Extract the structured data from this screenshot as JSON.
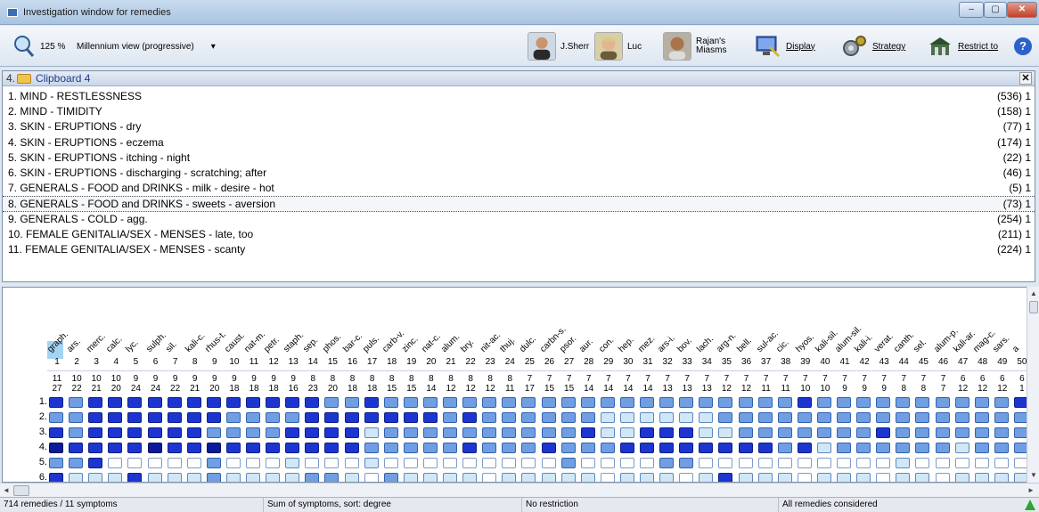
{
  "window": {
    "title": "Investigation window for remedies",
    "min": "–",
    "max": "▢",
    "close": "✕"
  },
  "toolbar": {
    "zoom": "125 %",
    "view": "Millennium view (progressive)",
    "view_arrow": "▾",
    "btn_sherr": "J.Sherr",
    "btn_luc": "Luc",
    "btn_rajan_1": "Rajan's",
    "btn_rajan_2": "Miasms",
    "btn_display": "Display",
    "btn_strategy": "Strategy",
    "btn_restrict": "Restrict to",
    "help": "?"
  },
  "clipboard": {
    "number": "4.",
    "name": "Clipboard 4",
    "close": "✕",
    "rubrics": [
      {
        "label": "1. MIND - RESTLESSNESS",
        "count": "(536) 1"
      },
      {
        "label": "2. MIND - TIMIDITY",
        "count": "(158) 1"
      },
      {
        "label": "3. SKIN - ERUPTIONS - dry",
        "count": "(77) 1"
      },
      {
        "label": "4. SKIN - ERUPTIONS - eczema",
        "count": "(174) 1"
      },
      {
        "label": "5. SKIN - ERUPTIONS - itching - night",
        "count": "(22) 1"
      },
      {
        "label": "6. SKIN - ERUPTIONS - discharging - scratching; after",
        "count": "(46) 1"
      },
      {
        "label": "7. GENERALS - FOOD and DRINKS - milk - desire - hot",
        "count": "(5) 1"
      },
      {
        "label": "8. GENERALS - FOOD and DRINKS - sweets - aversion",
        "count": "(73) 1"
      },
      {
        "label": "9. GENERALS - COLD - agg.",
        "count": "(254) 1"
      },
      {
        "label": "10. FEMALE GENITALIA/SEX - MENSES - late, too",
        "count": "(211) 1"
      },
      {
        "label": "11. FEMALE GENITALIA/SEX - MENSES - scanty",
        "count": "(224) 1"
      }
    ]
  },
  "grid": {
    "remedies": [
      "graph.",
      "ars.",
      "merc.",
      "calc.",
      "lyc.",
      "sulph.",
      "sil.",
      "kali-c.",
      "rhus-t.",
      "caust.",
      "nat-m.",
      "petr.",
      "staph.",
      "sep.",
      "phos.",
      "bar-c.",
      "puls.",
      "carb-v.",
      "zinc.",
      "nat-c.",
      "alum.",
      "bry.",
      "nit-ac.",
      "thuj.",
      "dulc.",
      "carbn-s.",
      "psor.",
      "aur.",
      "con.",
      "hep.",
      "mez.",
      "ars-i.",
      "bov.",
      "lach.",
      "arg-n.",
      "bell.",
      "sul-ac.",
      "cic.",
      "hyos.",
      "kali-sil.",
      "alum-sil.",
      "kali-i.",
      "verat.",
      "canth.",
      "sel.",
      "alum-p.",
      "kali-ar.",
      "mag-c.",
      "sars.",
      "a"
    ],
    "ranks": [
      "1",
      "2",
      "3",
      "4",
      "5",
      "6",
      "7",
      "8",
      "9",
      "10",
      "11",
      "12",
      "13",
      "14",
      "15",
      "16",
      "17",
      "18",
      "19",
      "20",
      "21",
      "22",
      "23",
      "24",
      "25",
      "26",
      "27",
      "28",
      "29",
      "30",
      "31",
      "32",
      "33",
      "34",
      "35",
      "36",
      "37",
      "38",
      "39",
      "40",
      "41",
      "42",
      "43",
      "44",
      "45",
      "46",
      "47",
      "48",
      "49",
      "50"
    ],
    "symptom_counts": [
      "11",
      "10",
      "10",
      "10",
      "9",
      "9",
      "9",
      "9",
      "9",
      "9",
      "9",
      "9",
      "9",
      "8",
      "8",
      "8",
      "8",
      "8",
      "8",
      "8",
      "8",
      "8",
      "8",
      "8",
      "7",
      "7",
      "7",
      "7",
      "7",
      "7",
      "7",
      "7",
      "7",
      "7",
      "7",
      "7",
      "7",
      "7",
      "7",
      "7",
      "7",
      "7",
      "7",
      "7",
      "7",
      "7",
      "6",
      "6",
      "6",
      "6"
    ],
    "degree_sums": [
      "27",
      "22",
      "21",
      "20",
      "24",
      "24",
      "22",
      "21",
      "20",
      "18",
      "18",
      "18",
      "16",
      "23",
      "20",
      "18",
      "18",
      "15",
      "15",
      "14",
      "12",
      "12",
      "12",
      "11",
      "17",
      "15",
      "15",
      "14",
      "14",
      "14",
      "14",
      "13",
      "13",
      "13",
      "12",
      "12",
      "11",
      "11",
      "10",
      "10",
      "9",
      "9",
      "9",
      "8",
      "8",
      "7",
      "12",
      "12",
      "12",
      "1"
    ],
    "row_labels": [
      "1.",
      "2.",
      "3.",
      "4.",
      "5.",
      "6."
    ],
    "cells": [
      [
        3,
        2,
        3,
        3,
        3,
        3,
        3,
        3,
        3,
        3,
        3,
        3,
        3,
        3,
        2,
        2,
        3,
        2,
        2,
        2,
        2,
        2,
        2,
        2,
        2,
        2,
        2,
        2,
        2,
        2,
        2,
        2,
        2,
        2,
        2,
        2,
        2,
        2,
        3,
        2,
        2,
        2,
        2,
        2,
        2,
        2,
        2,
        2,
        2,
        3
      ],
      [
        2,
        2,
        3,
        3,
        3,
        3,
        3,
        3,
        3,
        2,
        2,
        2,
        2,
        3,
        3,
        3,
        3,
        3,
        3,
        3,
        2,
        3,
        2,
        2,
        2,
        2,
        2,
        2,
        1,
        1,
        1,
        1,
        1,
        1,
        2,
        2,
        2,
        2,
        2,
        2,
        2,
        2,
        2,
        2,
        2,
        2,
        2,
        2,
        2,
        2
      ],
      [
        3,
        2,
        3,
        3,
        3,
        3,
        3,
        3,
        2,
        2,
        2,
        2,
        3,
        3,
        3,
        3,
        1,
        2,
        2,
        2,
        2,
        2,
        2,
        2,
        2,
        2,
        2,
        3,
        1,
        1,
        3,
        3,
        3,
        1,
        1,
        2,
        2,
        2,
        2,
        2,
        2,
        2,
        3,
        2,
        2,
        2,
        2,
        2,
        2,
        2
      ],
      [
        4,
        3,
        3,
        3,
        3,
        4,
        3,
        3,
        4,
        3,
        3,
        3,
        3,
        3,
        3,
        3,
        2,
        2,
        2,
        2,
        2,
        3,
        2,
        2,
        2,
        3,
        2,
        2,
        2,
        3,
        3,
        3,
        3,
        3,
        3,
        3,
        3,
        2,
        3,
        1,
        2,
        2,
        2,
        2,
        2,
        2,
        1,
        2,
        2,
        2
      ],
      [
        2,
        2,
        3,
        0,
        0,
        0,
        0,
        0,
        2,
        0,
        0,
        0,
        1,
        0,
        0,
        0,
        1,
        0,
        0,
        0,
        0,
        0,
        0,
        0,
        0,
        0,
        2,
        0,
        0,
        0,
        0,
        2,
        2,
        0,
        0,
        0,
        0,
        0,
        0,
        0,
        0,
        0,
        0,
        1,
        0,
        0,
        0,
        0,
        0,
        0
      ],
      [
        3,
        1,
        1,
        1,
        3,
        1,
        1,
        1,
        2,
        1,
        1,
        1,
        1,
        2,
        2,
        1,
        0,
        2,
        1,
        1,
        1,
        1,
        0,
        1,
        1,
        1,
        1,
        1,
        0,
        1,
        1,
        1,
        0,
        1,
        3,
        1,
        1,
        1,
        0,
        1,
        1,
        1,
        0,
        1,
        1,
        0,
        1,
        1,
        1,
        1
      ]
    ]
  },
  "scroll": {
    "up": "▲",
    "down": "▼",
    "left": "◄",
    "right": "►"
  },
  "status": {
    "counts": "714 remedies / 11 symptoms",
    "sort": "Sum of symptoms, sort: degree",
    "restriction": "No restriction",
    "considered": "All remedies considered"
  }
}
